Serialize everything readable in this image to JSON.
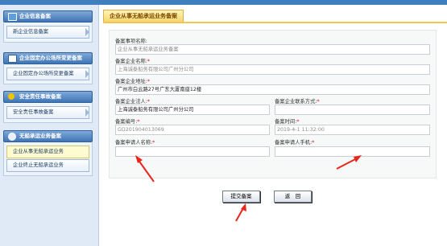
{
  "sidebar": {
    "sections": [
      {
        "title": "企业信息备案",
        "items": [
          "新企业信息备案"
        ]
      },
      {
        "title": "企业固定办公场所变更备案",
        "items": [
          "企业固定办公场所变更备案"
        ]
      },
      {
        "title": "安全责任事故备案",
        "items": [
          "安全责任事故备案"
        ]
      },
      {
        "title": "无船承运业务备案",
        "items": [
          "企业从事无船承运业务",
          "企业终止无船承运业务"
        ]
      }
    ]
  },
  "main": {
    "tab_title": "企业从事无船承运业务备案",
    "fields": {
      "record_name": {
        "label": "备案事项名称:",
        "value": "企业从事无船承运业务备案"
      },
      "company_name": {
        "label": "备案企业名称:",
        "value": "上海诚泰船务有限公司广州分公司"
      },
      "company_address": {
        "label": "备案企业地址:",
        "value": "广州市白云路27号广东大厦南座12楼"
      },
      "legal_person": {
        "label": "备案企业法人:",
        "value": "上海诚泰船务有限公司广州分公司"
      },
      "contact": {
        "label": "备案企业联系方式:",
        "value": ""
      },
      "record_no": {
        "label": "备案编号:",
        "value": "GD201904013069"
      },
      "record_time": {
        "label": "备案时间:",
        "value": "2019-4-1 11:32:00"
      },
      "applicant_name": {
        "label": "备案申请人名称:",
        "value": ""
      },
      "applicant_phone": {
        "label": "备案申请人手机:",
        "value": ""
      }
    },
    "required_mark": "*",
    "submit_label": "提交备案",
    "back_label": "返　回"
  },
  "colors": {
    "accent": "#3f75b6",
    "tab": "#f3d46d",
    "required": "#e0002a",
    "annotation_arrow": "#e8261b"
  }
}
